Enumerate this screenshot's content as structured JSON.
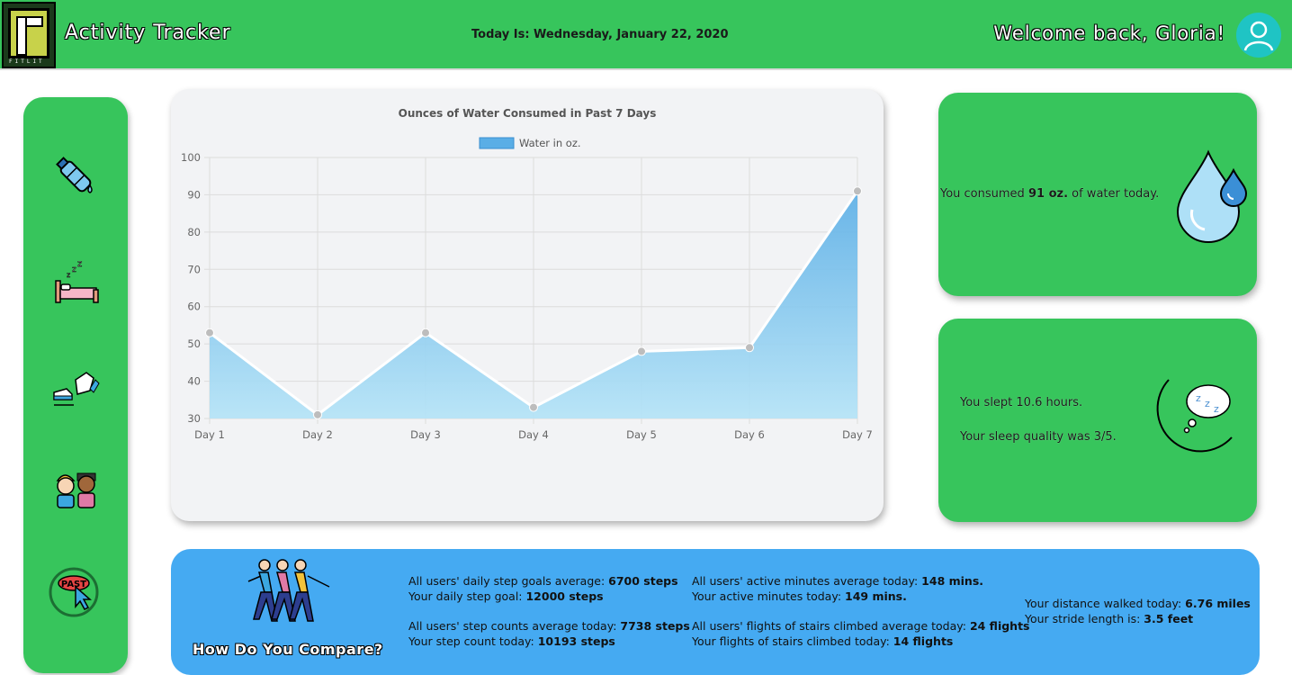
{
  "header": {
    "app_title": "Activity Tracker",
    "logo_text": "FITLIT",
    "today_label": "Today Is: Wednesday, January 22, 2020",
    "welcome": "Welcome back, Gloria!"
  },
  "sidebar": {
    "items": [
      {
        "name": "water",
        "icon": "water-bottle-icon"
      },
      {
        "name": "sleep",
        "icon": "bed-icon"
      },
      {
        "name": "activity",
        "icon": "shoes-icon"
      },
      {
        "name": "friends",
        "icon": "users-icon"
      },
      {
        "name": "past",
        "icon": "past-button-icon",
        "label": "PAST"
      }
    ]
  },
  "chart_data": {
    "type": "area",
    "title": "Ounces of Water Consumed in Past 7 Days",
    "categories": [
      "Day 1",
      "Day 2",
      "Day 3",
      "Day 4",
      "Day 5",
      "Day 6",
      "Day 7"
    ],
    "series": [
      {
        "name": "Water in oz.",
        "values": [
          53,
          31,
          53,
          33,
          48,
          49,
          91
        ]
      }
    ],
    "ylim": [
      30,
      100
    ],
    "yticks": [
      30,
      40,
      50,
      60,
      70,
      80,
      90,
      100
    ],
    "grid": true,
    "legend": "top-center",
    "colors": {
      "fill_top": "#5aaee6",
      "fill_bottom": "#b3e3f7",
      "line": "#ffffff",
      "point": "#bdbdbd"
    }
  },
  "water_card": {
    "text_before": "You consumed ",
    "amount": "91 oz.",
    "text_after": " of water today."
  },
  "sleep_card": {
    "hours_text": "You slept 10.6 hours.",
    "quality_text": "Your sleep quality was 3/5."
  },
  "compare": {
    "title": "How Do You Compare?",
    "steps_goal_avg_label": "All users' daily step goals average: ",
    "steps_goal_avg_value": "6700 steps",
    "your_goal_label": "Your daily step goal: ",
    "your_goal_value": "12000 steps",
    "steps_avg_label": "All users' step counts average today: ",
    "steps_avg_value": "7738 steps",
    "your_steps_label": "Your step count today: ",
    "your_steps_value": "10193 steps",
    "active_avg_label": "All users' active minutes average today: ",
    "active_avg_value": "148 mins.",
    "your_active_label": "Your active minutes today: ",
    "your_active_value": "149 mins.",
    "stairs_avg_label": "All users' flights of stairs climbed average today: ",
    "stairs_avg_value": "24 flights",
    "your_stairs_label": "Your flights of stairs climbed today: ",
    "your_stairs_value": "14 flights",
    "distance_label": "Your distance walked today: ",
    "distance_value": "6.76 miles",
    "stride_label": "Your stride length is: ",
    "stride_value": "3.5 feet"
  },
  "colors": {
    "brand_green": "#37c55c",
    "compare_blue": "#45aaf2",
    "avatar_teal": "#1fc4c4"
  }
}
